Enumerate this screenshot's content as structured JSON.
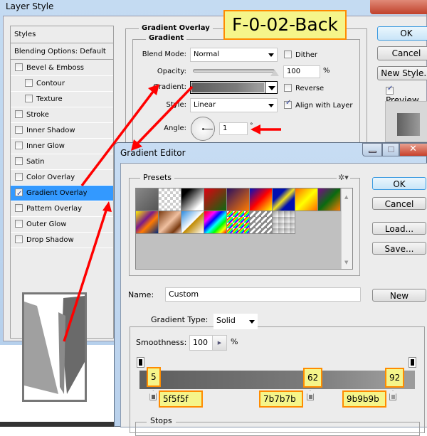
{
  "layer_style": {
    "title": "Layer Style",
    "styles_panel": {
      "header": "Styles",
      "blending": "Blending Options: Default",
      "items": [
        {
          "label": "Bevel & Emboss",
          "checked": false,
          "indent": false
        },
        {
          "label": "Contour",
          "checked": false,
          "indent": true
        },
        {
          "label": "Texture",
          "checked": false,
          "indent": true
        },
        {
          "label": "Stroke",
          "checked": false,
          "indent": false
        },
        {
          "label": "Inner Shadow",
          "checked": false,
          "indent": false
        },
        {
          "label": "Inner Glow",
          "checked": false,
          "indent": false
        },
        {
          "label": "Satin",
          "checked": false,
          "indent": false
        },
        {
          "label": "Color Overlay",
          "checked": false,
          "indent": false
        },
        {
          "label": "Gradient Overlay",
          "checked": true,
          "indent": false,
          "selected": true
        },
        {
          "label": "Pattern Overlay",
          "checked": false,
          "indent": false
        },
        {
          "label": "Outer Glow",
          "checked": false,
          "indent": false
        },
        {
          "label": "Drop Shadow",
          "checked": false,
          "indent": false
        }
      ]
    },
    "section_title": "Gradient Overlay",
    "group_title": "Gradient",
    "blend_mode_label": "Blend Mode:",
    "blend_mode_value": "Normal",
    "dither_label": "Dither",
    "dither_checked": false,
    "opacity_label": "Opacity:",
    "opacity_value": "100",
    "opacity_unit": "%",
    "opacity_slider_percent": 100,
    "gradient_label": "Gradient:",
    "reverse_label": "Reverse",
    "reverse_checked": false,
    "style_label": "Style:",
    "style_value": "Linear",
    "align_label": "Align with Layer",
    "align_checked": true,
    "angle_label": "Angle:",
    "angle_value": "1",
    "angle_unit": "°",
    "buttons": {
      "ok": "OK",
      "cancel": "Cancel",
      "new_style": "New Style...",
      "preview": "Preview"
    },
    "preview_checked": true
  },
  "callout_title": "F-0-02-Back",
  "gradient_editor": {
    "title": "Gradient Editor",
    "presets_label": "Presets",
    "buttons": {
      "ok": "OK",
      "cancel": "Cancel",
      "load": "Load...",
      "save": "Save...",
      "new": "New"
    },
    "name_label": "Name:",
    "name_value": "Custom",
    "gradient_type_label": "Gradient Type:",
    "gradient_type_value": "Solid",
    "smoothness_label": "Smoothness:",
    "smoothness_value": "100",
    "smoothness_unit": "%",
    "stops_label": "Stops",
    "color_stops": [
      {
        "location": 5,
        "color": "#5f5f5f",
        "hex_label": "5f5f5f"
      },
      {
        "location": 62,
        "color": "#7b7b7b",
        "hex_label": "7b7b7b"
      },
      {
        "location": 92,
        "color": "#9b9b9b",
        "hex_label": "9b9b9b"
      }
    ],
    "stop_location_labels": [
      "5",
      "62",
      "92"
    ],
    "presets": [
      "linear-gradient(135deg,#888,#555)",
      "checker-gray",
      "linear-gradient(135deg,#000 20%,#fff 80%)",
      "linear-gradient(135deg,#e00010,#0a6a10)",
      "linear-gradient(135deg,#2a1060,#ff7a00)",
      "linear-gradient(135deg,#0010c0,#ff0000 50%,#ffff00)",
      "linear-gradient(135deg,#0010b0 30%,#f0e020 50%,#0010b0 70%)",
      "linear-gradient(135deg,#ff6a00,#ffff00 50%,#ff6a00)",
      "linear-gradient(135deg,#7a0a8a,#0a6a10 50%,#ff7a00)",
      "linear-gradient(135deg,#ffee00,#7a1a8a 40%,#ff7a00 60%,#002a80)",
      "linear-gradient(135deg,#7a3a10,#f0c0a0 50%,#7a3a10 80%,#f0d0c0)",
      "linear-gradient(135deg,#2a8ae0,#fff 50%,#c08a00 52%,#fff)",
      "linear-gradient(135deg,#ff0000,#ff00ff 25%,#0000ff 40%,#00ffff 55%,#00ff00 70%,#ffff00 85%,#ff0000)",
      "rainbow-checker",
      "stripes-checker",
      "checker-fade"
    ]
  }
}
